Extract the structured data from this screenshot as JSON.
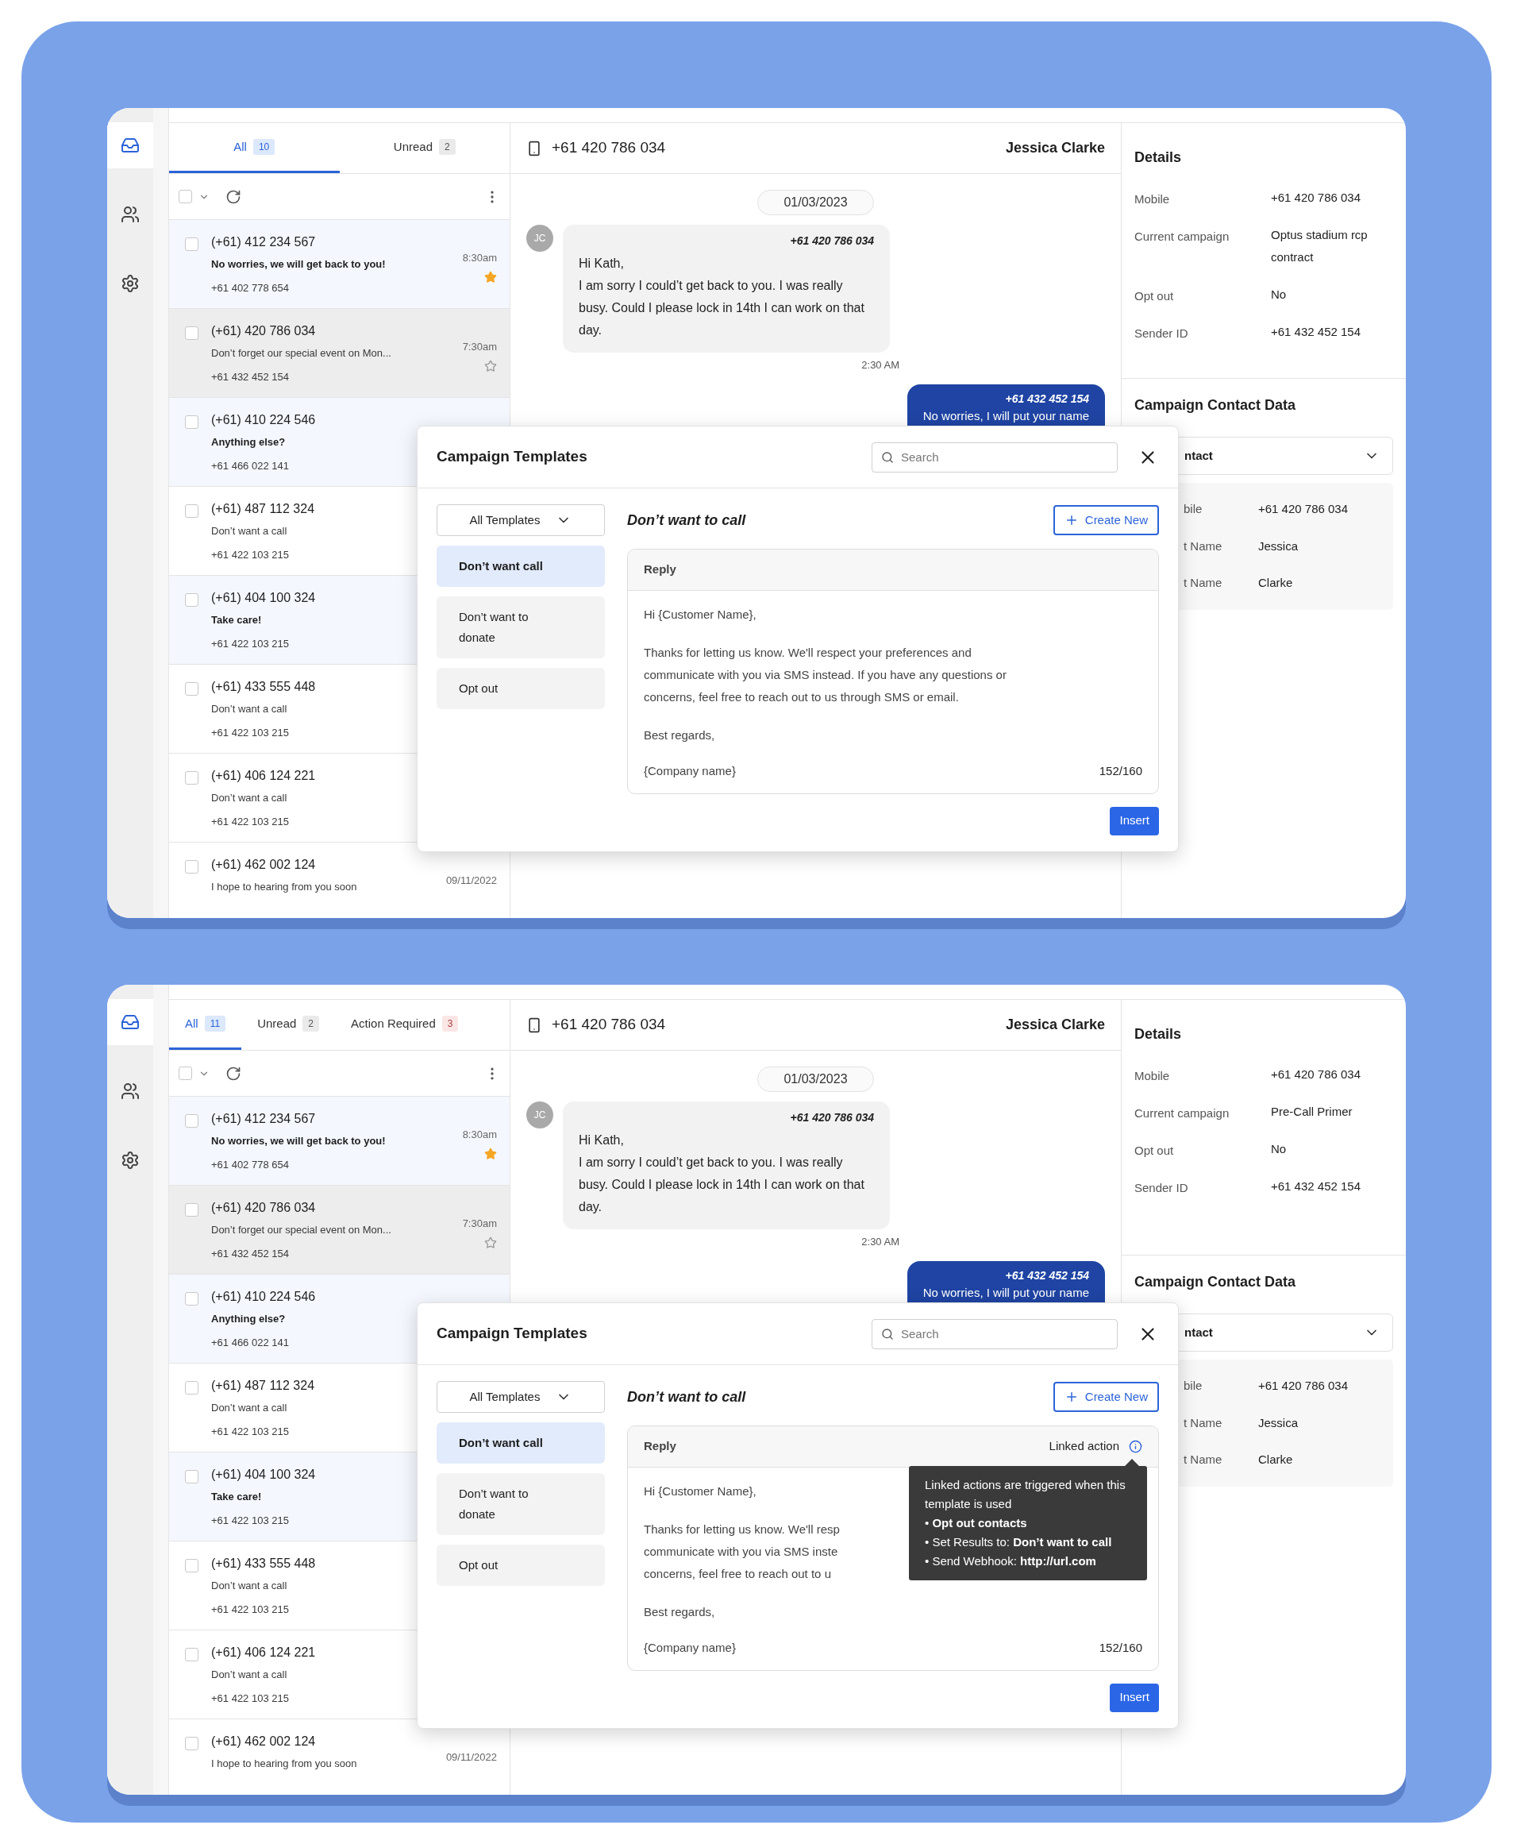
{
  "panels": [
    {
      "rail": [
        {
          "kind": "inbox",
          "selected": true
        },
        {
          "kind": "contacts",
          "selected": false
        },
        {
          "kind": "settings",
          "selected": false
        }
      ],
      "inbox": {
        "tabs": [
          {
            "label": "All",
            "count": "10",
            "selected": true,
            "alert": false
          },
          {
            "label": "Unread",
            "count": "2",
            "selected": false,
            "alert": false
          }
        ],
        "select_all_checked": false,
        "conversations": [
          {
            "phone": "(+61) 412 234 567",
            "preview": "No worries, we will get back to you!",
            "sender": "+61 402 778 654",
            "time": "8:30am",
            "starred": true,
            "unread": true,
            "selected": false,
            "checked": false
          },
          {
            "phone": "(+61) 420 786 034",
            "preview": "Don’t forget our special event on Mon...",
            "sender": "+61 432 452 154",
            "time": "7:30am",
            "starred": false,
            "unread": false,
            "selected": true,
            "checked": false
          },
          {
            "phone": "(+61) 410 224 546",
            "preview": "Anything else?",
            "sender": "+61 466 022 141",
            "unread": true,
            "selected": false,
            "checked": false
          },
          {
            "phone": "(+61) 487 112 324",
            "preview": "Don’t want a call",
            "sender": "+61 422 103 215",
            "unread": false,
            "selected": false,
            "checked": false
          },
          {
            "phone": "(+61) 404 100 324",
            "preview": "Take care!",
            "sender": "+61 422 103 215",
            "unread": true,
            "selected": false,
            "checked": false
          },
          {
            "phone": "(+61) 433 555 448",
            "preview": "Don’t want a call",
            "sender": "+61 422 103 215",
            "unread": false,
            "selected": false,
            "checked": false
          },
          {
            "phone": "(+61) 406 124 221",
            "preview": "Don’t want a call",
            "sender": "+61 422 103 215",
            "unread": false,
            "selected": false,
            "checked": false
          },
          {
            "phone": "(+61) 462 002 124",
            "preview": "I hope to hearing from you soon",
            "time": "09/11/2022",
            "unread": false,
            "selected": false,
            "checked": false
          }
        ]
      },
      "chat": {
        "phone": "+61 420 786 034",
        "contact": "Jessica Clarke",
        "date": "01/03/2023",
        "messages": [
          {
            "kind": "incoming",
            "avatar": "JC",
            "sender": "+61 420 786 034",
            "text": "Hi Kath,\nI am sorry I could’t get back to you. I was really busy. Could I please lock in 14th I can work on that day.",
            "time": "2:30 AM"
          },
          {
            "kind": "outgoing",
            "sender": "+61 432 452 154",
            "text": "No worries, I will put your name"
          }
        ]
      },
      "details": {
        "title": "Details",
        "fields": [
          {
            "label": "Mobile",
            "value": "+61 420 786 034"
          },
          {
            "label": "Current campaign",
            "value": "Optus stadium rcp contract"
          },
          {
            "label": "Opt out",
            "value": "No"
          },
          {
            "label": "Sender ID",
            "value": "+61 432 452 154"
          }
        ],
        "contact_data": {
          "title": "Campaign Contact Data",
          "dropdown": "ntact",
          "fields": [
            {
              "label": "bile",
              "value": "+61 420 786 034"
            },
            {
              "label": "t Name",
              "value": "Jessica"
            },
            {
              "label": "t Name",
              "value": "Clarke"
            }
          ]
        }
      },
      "modal": {
        "title": "Campaign Templates",
        "search": {
          "placeholder": "Search"
        },
        "filter": "All Templates",
        "templates": [
          {
            "label": "Don’t want call",
            "selected": true
          },
          {
            "label": "Don’t want to donate",
            "selected": false
          },
          {
            "label": "Opt out",
            "selected": false
          }
        ],
        "template_title": "Don’t want to call",
        "create_button": "Create New",
        "reply": {
          "label": "Reply",
          "paragraphs": [
            "Hi {Customer Name},",
            "Thanks for letting us know. We'll respect your preferences and\ncommunicate with you via SMS instead. If you have any questions or\nconcerns, feel free to reach out to us through SMS or email.",
            "Best regards,"
          ],
          "footer": "{Company name}",
          "count": "152/160"
        },
        "insert_button": "Insert"
      }
    },
    {
      "rail": [
        {
          "kind": "inbox",
          "selected": true
        },
        {
          "kind": "contacts",
          "selected": false
        },
        {
          "kind": "settings",
          "selected": false
        }
      ],
      "inbox": {
        "tabs": [
          {
            "label": "All",
            "count": "11",
            "selected": true,
            "alert": false
          },
          {
            "label": "Unread",
            "count": "2",
            "selected": false,
            "alert": false
          },
          {
            "label": "Action Required",
            "count": "3",
            "selected": false,
            "alert": true
          }
        ],
        "select_all_checked": false,
        "conversations": [
          {
            "phone": "(+61) 412 234 567",
            "preview": "No worries, we will get back to you!",
            "sender": "+61 402 778 654",
            "time": "8:30am",
            "starred": true,
            "unread": true,
            "selected": false,
            "checked": false
          },
          {
            "phone": "(+61) 420 786 034",
            "preview": "Don’t forget our special event on Mon...",
            "sender": "+61 432 452 154",
            "time": "7:30am",
            "starred": false,
            "unread": false,
            "selected": true,
            "checked": false
          },
          {
            "phone": "(+61) 410 224 546",
            "preview": "Anything else?",
            "sender": "+61 466 022 141",
            "unread": true,
            "selected": false,
            "checked": false
          },
          {
            "phone": "(+61) 487 112 324",
            "preview": "Don’t want a call",
            "sender": "+61 422 103 215",
            "unread": false,
            "selected": false,
            "checked": false
          },
          {
            "phone": "(+61) 404 100 324",
            "preview": "Take care!",
            "sender": "+61 422 103 215",
            "unread": true,
            "selected": false,
            "checked": false
          },
          {
            "phone": "(+61) 433 555 448",
            "preview": "Don’t want a call",
            "sender": "+61 422 103 215",
            "unread": false,
            "selected": false,
            "checked": false
          },
          {
            "phone": "(+61) 406 124 221",
            "preview": "Don’t want a call",
            "sender": "+61 422 103 215",
            "unread": false,
            "selected": false,
            "checked": false
          },
          {
            "phone": "(+61) 462 002 124",
            "preview": "I hope to hearing from you soon",
            "time": "09/11/2022",
            "unread": false,
            "selected": false,
            "checked": false
          }
        ]
      },
      "chat": {
        "phone": "+61 420 786 034",
        "contact": "Jessica Clarke",
        "date": "01/03/2023",
        "messages": [
          {
            "kind": "incoming",
            "avatar": "JC",
            "sender": "+61 420 786 034",
            "text": "Hi Kath,\nI am sorry I could’t get back to you. I was really busy. Could I please lock in 14th I can work on that day.",
            "time": "2:30 AM"
          },
          {
            "kind": "outgoing",
            "sender": "+61 432 452 154",
            "text": "No worries, I will put your name"
          }
        ]
      },
      "details": {
        "title": "Details",
        "fields": [
          {
            "label": "Mobile",
            "value": "+61 420 786 034"
          },
          {
            "label": "Current campaign",
            "value": "Pre-Call Primer"
          },
          {
            "label": "Opt out",
            "value": "No"
          },
          {
            "label": "Sender ID",
            "value": "+61 432 452 154"
          }
        ],
        "contact_data": {
          "title": "Campaign Contact Data",
          "dropdown": "ntact",
          "fields": [
            {
              "label": "bile",
              "value": "+61 420 786 034"
            },
            {
              "label": "t Name",
              "value": "Jessica"
            },
            {
              "label": "t Name",
              "value": "Clarke"
            }
          ]
        }
      },
      "modal": {
        "title": "Campaign Templates",
        "search": {
          "placeholder": "Search"
        },
        "filter": "All Templates",
        "templates": [
          {
            "label": "Don’t want call",
            "selected": true
          },
          {
            "label": "Don’t want to donate",
            "selected": false
          },
          {
            "label": "Opt out",
            "selected": false
          }
        ],
        "template_title": "Don’t want to call",
        "create_button": "Create New",
        "reply": {
          "label": "Reply",
          "linked_action": {
            "label": "Linked action",
            "tooltip": {
              "text": "Linked actions are triggered when this template is used",
              "bullets": [
                "• **Opt out contacts**",
                "• Set Results to: **Don’t want to call**",
                "• Send Webhook: **http://url.com**"
              ]
            }
          },
          "paragraphs": [
            "Hi {Customer Name},",
            "Thanks for letting us know. We'll resp\ncommunicate with you via SMS inste\nconcerns, feel free to reach out to u",
            "Best regards,"
          ],
          "footer": "{Company name}",
          "count": "152/160"
        },
        "insert_button": "Insert"
      }
    }
  ]
}
